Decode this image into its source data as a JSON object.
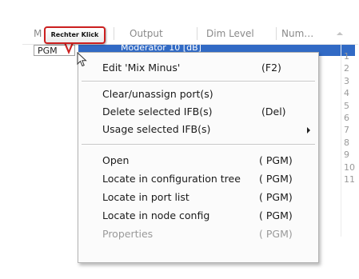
{
  "table": {
    "headers": [
      "M",
      "Output",
      "Dim Level",
      "Num…"
    ],
    "first_cell": "PGM",
    "selected_row": "Moderator   10 [dB]",
    "row_numbers": [
      "1",
      "2",
      "3",
      "4",
      "5",
      "6",
      "7",
      "8",
      "9",
      "10",
      "11"
    ]
  },
  "callout": {
    "text": "Rechter Klick",
    "border_color": "#cc2020"
  },
  "menu": {
    "items": [
      {
        "label": "Edit 'Mix Minus'",
        "shortcut": "(F2)"
      },
      {
        "label": "Clear/unassign port(s)",
        "shortcut": ""
      },
      {
        "label": "Delete selected IFB(s)",
        "shortcut": "(Del)"
      },
      {
        "label": "Usage selected IFB(s)",
        "shortcut": "",
        "submenu": true
      },
      {
        "label": "Open",
        "shortcut": "( PGM)"
      },
      {
        "label": "Locate in configuration tree",
        "shortcut": "( PGM)"
      },
      {
        "label": "Locate in port list",
        "shortcut": "( PGM)"
      },
      {
        "label": "Locate in node config",
        "shortcut": "( PGM)"
      },
      {
        "label": "Properties",
        "shortcut": "( PGM)",
        "disabled": true
      }
    ]
  },
  "colors": {
    "selection": "#316ac5",
    "menu_bg": "#fbfbfb"
  }
}
